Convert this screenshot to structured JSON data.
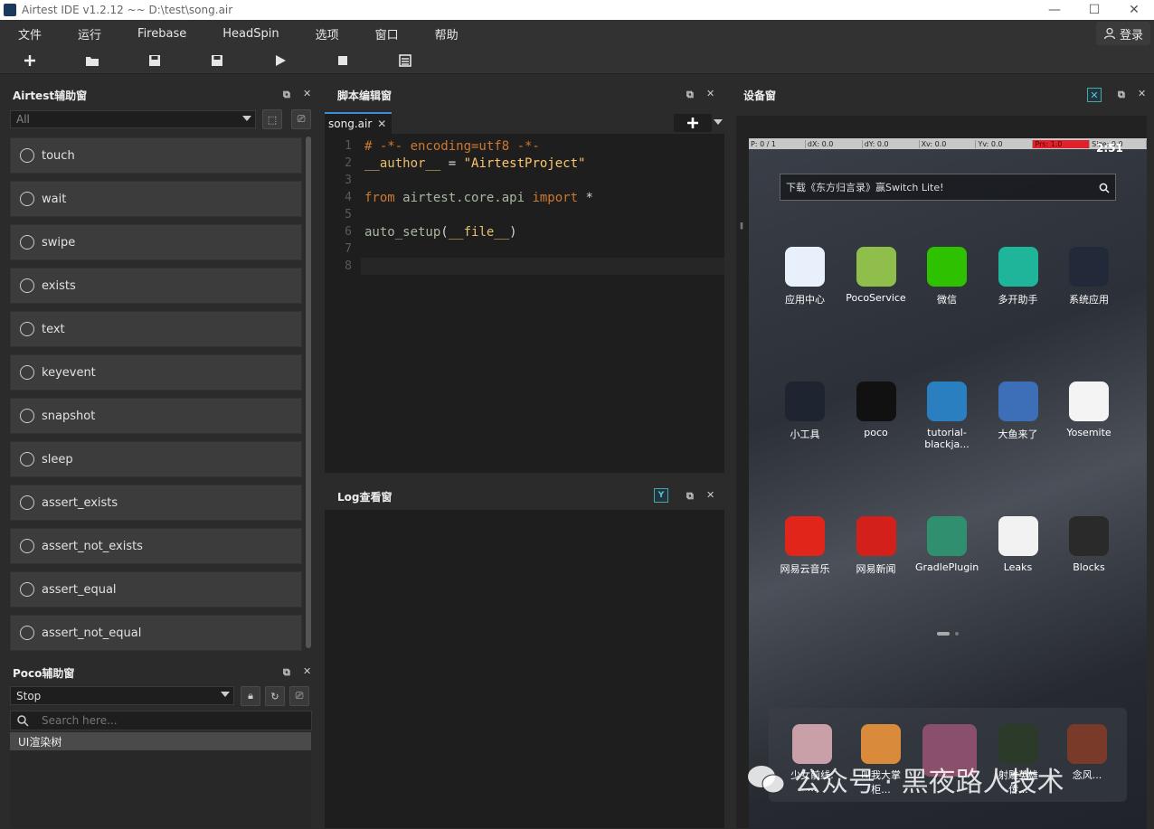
{
  "window": {
    "title": "Airtest IDE v1.2.12 ~~ D:\\test\\song.air",
    "min": "—",
    "max": "☐",
    "close": "✕"
  },
  "menu": [
    "文件",
    "运行",
    "Firebase",
    "HeadSpin",
    "选项",
    "窗口",
    "帮助"
  ],
  "login_label": "登录",
  "airtest_panel": {
    "title": "Airtest辅助窗",
    "filter_value": "All",
    "buttons": [
      "touch",
      "wait",
      "swipe",
      "exists",
      "text",
      "keyevent",
      "snapshot",
      "sleep",
      "assert_exists",
      "assert_not_exists",
      "assert_equal",
      "assert_not_equal"
    ]
  },
  "poco_panel": {
    "title": "Poco辅助窗",
    "mode_value": "Stop",
    "search_placeholder": "Search here...",
    "tree_root": "UI渲染树"
  },
  "editor": {
    "title": "脚本编辑窗",
    "tab": "song.air",
    "lines": [
      {
        "num": "1",
        "parts": [
          [
            "# -*- encoding=utf8 -*-",
            "#cc7832"
          ]
        ]
      },
      {
        "num": "2",
        "parts": [
          [
            "__author__",
            "#e8bf6a"
          ],
          [
            " = ",
            "#d4d4d4"
          ],
          [
            "\"AirtestProject\"",
            "#ffc66d"
          ]
        ]
      },
      {
        "num": "3",
        "parts": []
      },
      {
        "num": "4",
        "parts": [
          [
            "from",
            "#cc7832"
          ],
          [
            " airtest.core.api ",
            "#a9b7a0"
          ],
          [
            "import",
            "#cc7832"
          ],
          [
            " *",
            "#d4d4d4"
          ]
        ]
      },
      {
        "num": "5",
        "parts": []
      },
      {
        "num": "6",
        "parts": [
          [
            "auto_setup",
            "#a9b7a0"
          ],
          [
            "(",
            "#d4d4d4"
          ],
          [
            "__file__",
            "#e8bf6a"
          ],
          [
            ")",
            "#d4d4d4"
          ]
        ]
      },
      {
        "num": "7",
        "parts": []
      },
      {
        "num": "8",
        "parts": []
      }
    ]
  },
  "log_panel": {
    "title": "Log查看窗"
  },
  "device_panel": {
    "title": "设备窗",
    "status": [
      "P: 0 / 1",
      "dX: 0.0",
      "dY: 0.0",
      "Xv: 0.0",
      "Yv: 0.0",
      "Prs: 1.0",
      "Size: 0.0"
    ],
    "time": "2:51",
    "search_text": "下载《东方归言录》赢Switch Lite!",
    "apps": [
      {
        "label": "应用中心",
        "color": "#e8f0fb"
      },
      {
        "label": "PocoService",
        "color": "#8fbf4a"
      },
      {
        "label": "微信",
        "color": "#2dc100"
      },
      {
        "label": "多开助手",
        "color": "#1fb59a"
      },
      {
        "label": "系统应用",
        "color": "#222a3a"
      },
      {
        "label": "小工具",
        "color": "#1f2530"
      },
      {
        "label": "poco",
        "color": "#111111"
      },
      {
        "label": "tutorial-blackja...",
        "color": "#2a7fc0"
      },
      {
        "label": "大鱼来了",
        "color": "#3d6fb8"
      },
      {
        "label": "Yosemite",
        "color": "#f4f4f4"
      },
      {
        "label": "网易云音乐",
        "color": "#e1251b"
      },
      {
        "label": "网易新闻",
        "color": "#d3201a"
      },
      {
        "label": "GradlePlugin",
        "color": "#2f8f6f"
      },
      {
        "label": "Leaks",
        "color": "#f2f2f2"
      },
      {
        "label": "Blocks",
        "color": "#2a2a2a"
      }
    ],
    "dock": [
      {
        "label": "少女前线: ...",
        "color": "#c9a0a8"
      },
      {
        "label": "叫我大掌柜...",
        "color": "#d98a3a"
      },
      {
        "label": "",
        "color": "#8a4f6a"
      },
      {
        "label": "射雕英雄传...",
        "color": "#2c3a2a"
      },
      {
        "label": "念风...",
        "color": "#7a3a2a"
      }
    ],
    "watermark": "公众号 · 黑夜路人技术"
  }
}
